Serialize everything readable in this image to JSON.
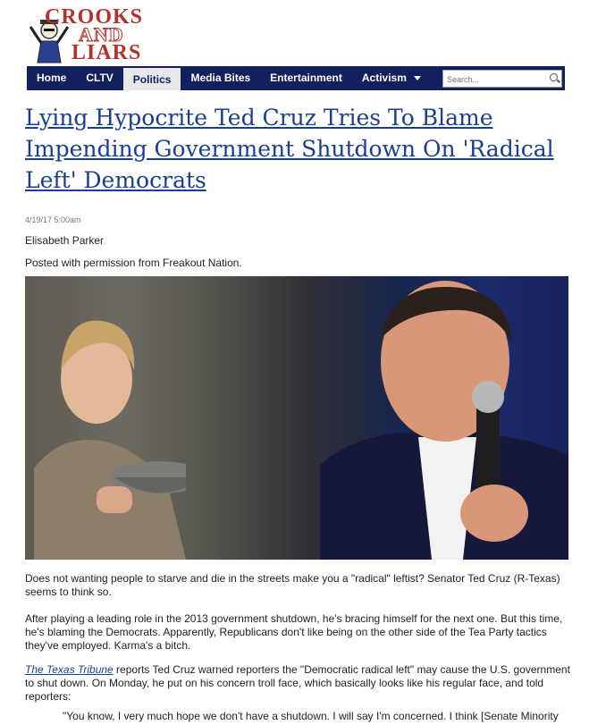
{
  "site": {
    "logo_line1": "CROOKS",
    "logo_line2": "AND",
    "logo_line3": "LIARS",
    "brand_color": "#b5312a"
  },
  "nav": {
    "background": "#12205e",
    "items": [
      {
        "label": "Home"
      },
      {
        "label": "CLTV"
      },
      {
        "label": "Politics",
        "active": true
      },
      {
        "label": "Media Bites"
      },
      {
        "label": "Entertainment"
      },
      {
        "label": "Activism"
      }
    ],
    "search_placeholder": "Search..."
  },
  "article": {
    "title": "Lying Hypocrite Ted Cruz Tries To Blame Impending Government Shutdown On 'Radical Left' Democrats",
    "date": "4/19/17 5:00am",
    "author": "Elisabeth Parker",
    "permission": "Posted with permission from Freakout Nation.",
    "paragraph1": "Does not wanting people to starve and die in the streets make you a \"radical\" leftist? Senator Ted Cruz (R-Texas) seems to think so.",
    "paragraph2": "After playing a leading role in the 2013 government shutdown, he's bracing himself for the next one. But this time, he's blaming the Democrats. Apparently, Republicans don't like being on the other side of the Tea Party tactics they've employed. Karma's a bitch.",
    "paragraph3_link": "The Texas Tribune",
    "paragraph3_rest": " reports Ted Cruz warned reporters the \"Democratic radical left\" may cause the U.S. government to shut down. On Monday, he put on his concern troll face, which basically looks like his regular face,  and told reporters:",
    "quote": "\"You know, I very much hope we don't have a shutdown.  I will say I'm concerned. I think [Senate Minority"
  }
}
